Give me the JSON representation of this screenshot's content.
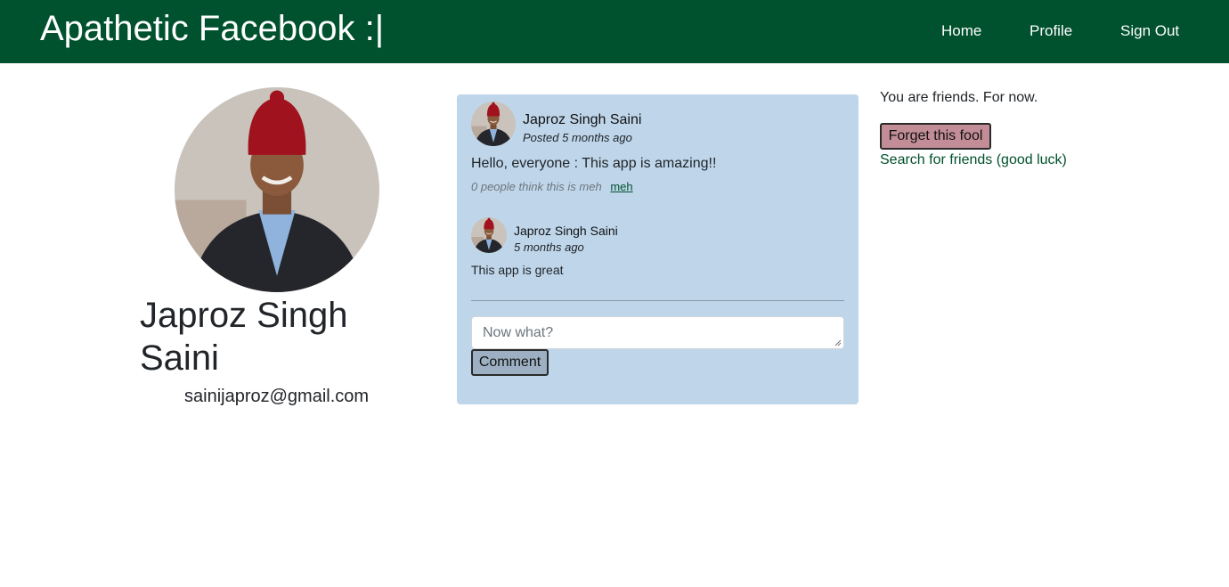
{
  "navbar": {
    "brand": "Apathetic Facebook :|",
    "links": {
      "home": "Home",
      "profile": "Profile",
      "sign_out": "Sign Out"
    },
    "background_color": "#00512d"
  },
  "profile": {
    "name": "Japroz Singh Saini",
    "email": "sainijaproz@gmail.com"
  },
  "post": {
    "author": "Japroz Singh Saini",
    "time": "Posted 5 months ago",
    "body": "Hello, everyone : This app is amazing!!",
    "meh_count_text": "0 people think this is meh",
    "meh_link": "meh",
    "card_color": "#bfd6ea"
  },
  "comment": {
    "author": "Japroz Singh Saini",
    "time": "5 months ago",
    "body": "This app is great"
  },
  "comment_form": {
    "placeholder": "Now what?",
    "submit_label": "Comment"
  },
  "friendship": {
    "status": "You are friends. For now.",
    "forget_label": "Forget this fool",
    "search_link": "Search for friends (good luck)"
  }
}
